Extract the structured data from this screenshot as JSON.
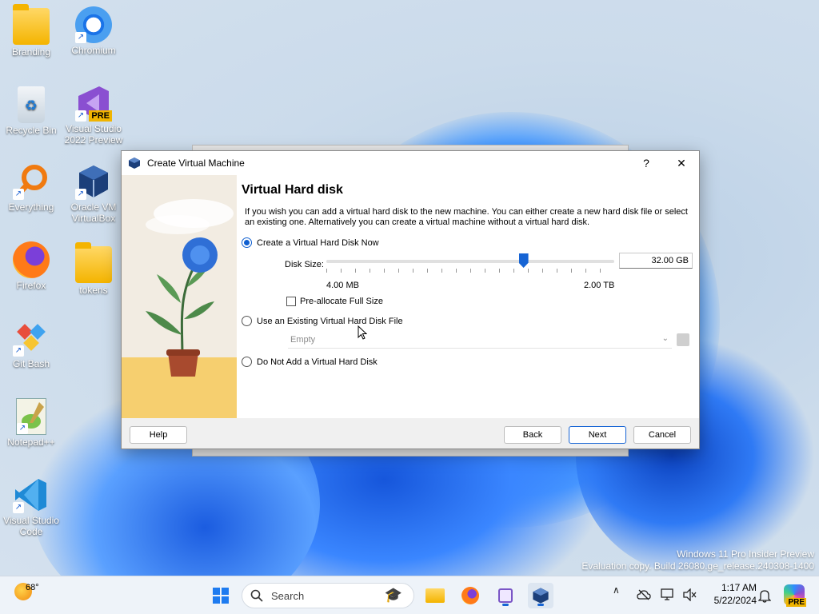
{
  "desktop": {
    "icons": [
      {
        "label": "Branding"
      },
      {
        "label": "Chromium"
      },
      {
        "label": "Recycle Bin"
      },
      {
        "label": "Visual Studio 2022 Preview",
        "badge": "PRE"
      },
      {
        "label": "Everything"
      },
      {
        "label": "Oracle VM VirtualBox"
      },
      {
        "label": "Firefox"
      },
      {
        "label": "tokens"
      },
      {
        "label": "Git Bash"
      },
      {
        "label": "Notepad++"
      },
      {
        "label": "Visual Studio Code"
      }
    ],
    "shortcut_glyph": "↗",
    "watermark_line1": "Windows 11 Pro Insider Preview",
    "watermark_line2": "Evaluation copy. Build 26080.ge_release.240308-1400"
  },
  "dialog": {
    "title": "Create Virtual Machine",
    "help_glyph": "?",
    "close_glyph": "✕",
    "heading": "Virtual Hard disk",
    "description": "If you wish you can add a virtual hard disk to the new machine. You can either create a new hard disk file or select an existing one. Alternatively you can create a virtual machine without a virtual hard disk.",
    "option_create": "Create a Virtual Hard Disk Now",
    "disk_size_label": "Disk Size:",
    "disk_size_value": "32.00 GB",
    "slider_min": "4.00 MB",
    "slider_max": "2.00 TB",
    "slider_position": 0.685,
    "preallocate": "Pre-allocate Full Size",
    "option_existing": "Use an Existing Virtual Hard Disk File",
    "existing_combo": "Empty",
    "option_none": "Do Not Add a Virtual Hard Disk",
    "buttons": {
      "help": "Help",
      "back": "Back",
      "next": "Next",
      "cancel": "Cancel"
    }
  },
  "taskbar": {
    "weather": "68°",
    "search_placeholder": "Search",
    "time": "1:17 AM",
    "date": "5/22/2024",
    "copilot_badge": "PRE",
    "tray_chevron": "∧"
  },
  "colors": {
    "accent": "#1664d4",
    "taskbar": "#eef3f9"
  }
}
